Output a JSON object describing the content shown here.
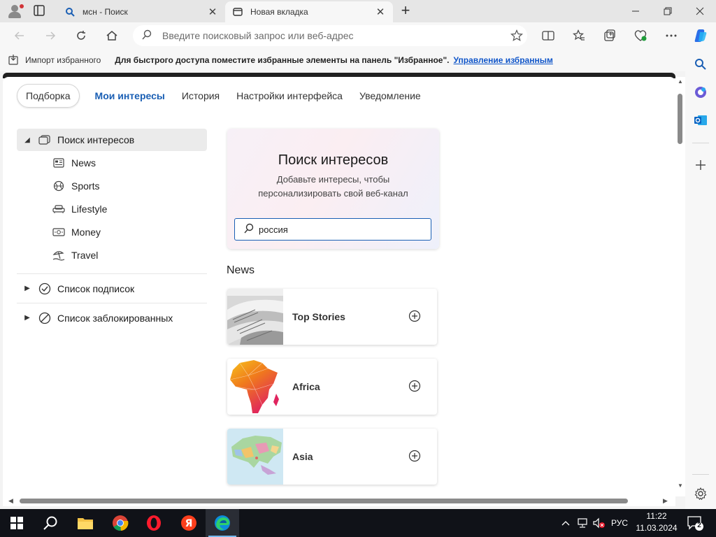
{
  "browser": {
    "tabs": [
      {
        "label": "мсн - Поиск",
        "active": false,
        "favicon": "search-icon"
      },
      {
        "label": "Новая вкладка",
        "active": true,
        "favicon": "newtab-icon"
      }
    ],
    "address_placeholder": "Введите поисковый запрос или веб-адрес",
    "address_value": ""
  },
  "favorites_bar": {
    "import_label": "Импорт избранного",
    "message": "Для быстрого доступа поместите избранные элементы на панель \"Избранное\".",
    "manage_link": "Управление избранным"
  },
  "page": {
    "tabs": [
      {
        "label": "Подборка",
        "style": "pill"
      },
      {
        "label": "Мои интересы",
        "style": "selected"
      },
      {
        "label": "История",
        "style": "normal"
      },
      {
        "label": "Настройки интерфейса",
        "style": "normal"
      },
      {
        "label": "Уведомление",
        "style": "normal"
      }
    ],
    "nav": {
      "head": {
        "label": "Поиск интересов",
        "expanded": true
      },
      "items": [
        {
          "label": "News",
          "icon": "newspaper-icon"
        },
        {
          "label": "Sports",
          "icon": "sports-ball-icon"
        },
        {
          "label": "Lifestyle",
          "icon": "sofa-icon"
        },
        {
          "label": "Money",
          "icon": "banknote-icon"
        },
        {
          "label": "Travel",
          "icon": "beach-umbrella-icon"
        }
      ],
      "groups": [
        {
          "label": "Список подписок",
          "icon": "check-circle-icon"
        },
        {
          "label": "Список заблокированных",
          "icon": "block-icon"
        }
      ]
    },
    "search_card": {
      "title": "Поиск интересов",
      "subtitle": "Добавьте интересы, чтобы персонализировать свой веб-канал",
      "query": "россия"
    },
    "section_title": "News",
    "interest_cards": [
      {
        "name": "Top Stories",
        "thumb": "newspapers"
      },
      {
        "name": "Africa",
        "thumb": "africa-map"
      },
      {
        "name": "Asia",
        "thumb": "asia-map"
      }
    ]
  },
  "taskbar": {
    "apps": [
      "start",
      "search",
      "file-explorer",
      "chrome",
      "opera",
      "yandex",
      "edge"
    ],
    "language": "РУС",
    "time": "11:22",
    "date": "11.03.2024",
    "notification_count": "2"
  },
  "colors": {
    "accent": "#1a5fb4",
    "link": "#0f55c9",
    "taskbar": "#101218"
  }
}
